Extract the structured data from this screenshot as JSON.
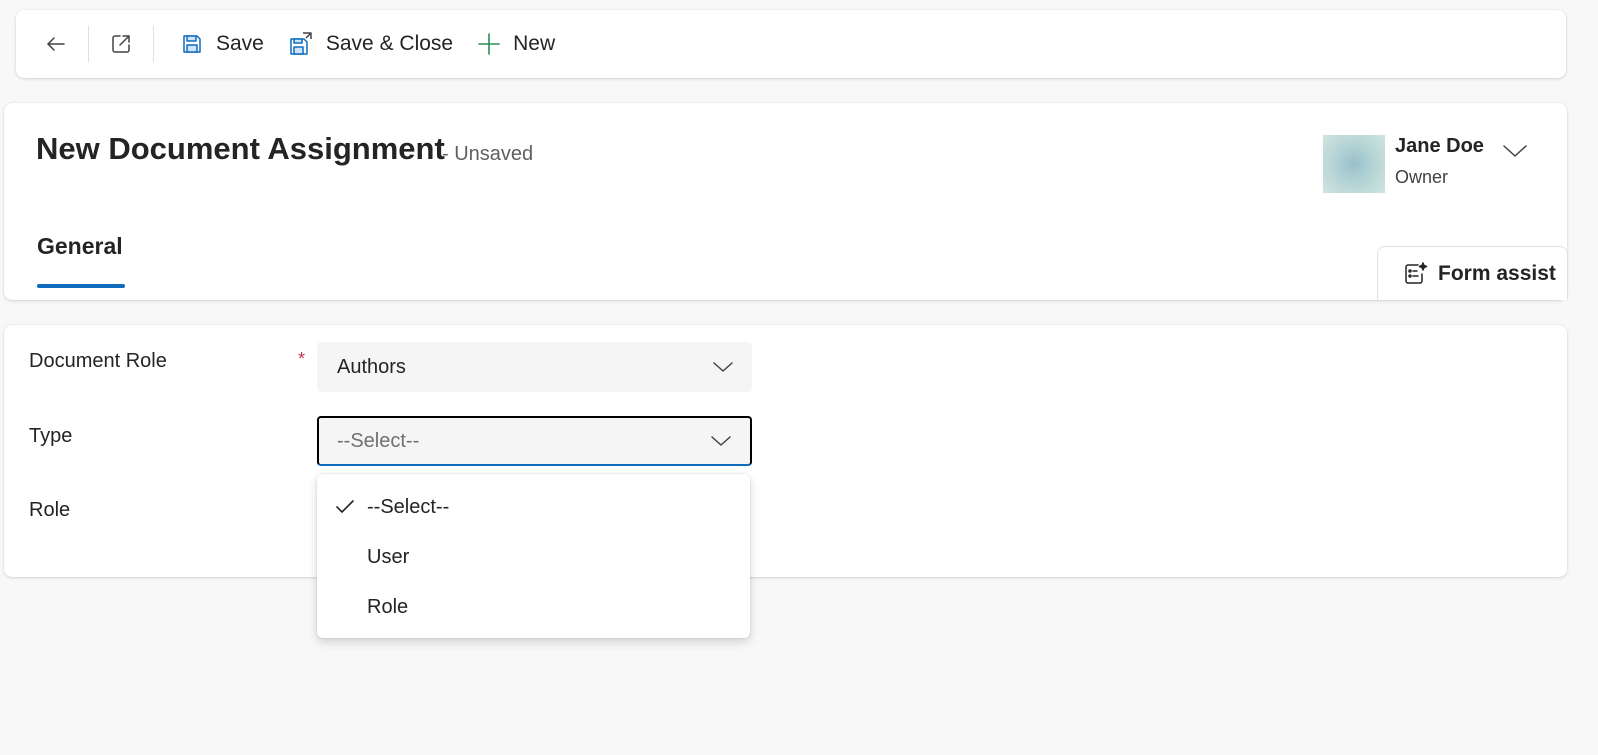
{
  "commandbar": {
    "back_icon": "arrow-left-icon",
    "popout_icon": "open-in-new-window-icon",
    "save_label": "Save",
    "save_close_label": "Save & Close",
    "new_label": "New"
  },
  "header": {
    "title": "New Document Assignment",
    "status": "- Unsaved",
    "owner_name": "Jane Doe",
    "owner_label": "Owner",
    "tabs": [
      {
        "label": "General",
        "selected": true
      }
    ],
    "form_assist_label": "Form assist"
  },
  "form": {
    "document_role": {
      "label": "Document Role",
      "required": "*",
      "value": "Authors"
    },
    "type": {
      "label": "Type",
      "value": "--Select--"
    },
    "role": {
      "label": "Role"
    }
  },
  "dropdown": {
    "options": [
      {
        "label": "--Select--",
        "selected": true
      },
      {
        "label": "User",
        "selected": false
      },
      {
        "label": "Role",
        "selected": false
      }
    ]
  },
  "colors": {
    "accent": "#0f6cbd",
    "new_icon": "#2e8b57",
    "required": "#c4314b"
  }
}
